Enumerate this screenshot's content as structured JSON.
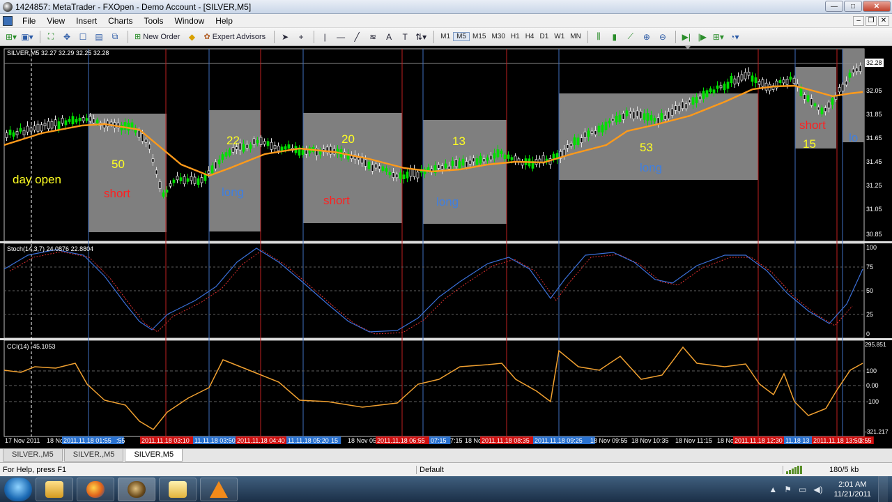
{
  "window": {
    "title": "1424857: MetaTrader - FXOpen - Demo Account - [SILVER,M5]",
    "controls": {
      "minimize": "—",
      "maximize": "□",
      "close": "✕"
    }
  },
  "menu": {
    "items": [
      "File",
      "View",
      "Insert",
      "Charts",
      "Tools",
      "Window",
      "Help"
    ],
    "mdi_controls": [
      "–",
      "❐",
      "✕"
    ]
  },
  "toolbar": {
    "new_order_label": "New Order",
    "expert_advisors_label": "Expert Advisors",
    "timeframes": [
      "M1",
      "M5",
      "M15",
      "M30",
      "H1",
      "H4",
      "D1",
      "W1",
      "MN"
    ],
    "active_timeframe": "M5",
    "icons": [
      "new-chart-icon",
      "profiles-icon",
      "zoom-chart-icon",
      "crosshair-icon",
      "navigator-icon",
      "terminal-icon",
      "tester-icon",
      "new-order-icon",
      "alert-icon",
      "expert-advisors-icon",
      "cursor-icon",
      "crosshair-tool-icon",
      "vertical-line-icon",
      "horizontal-line-icon",
      "trendline-icon",
      "fibonacci-icon",
      "text-icon",
      "label-icon",
      "arrows-icon",
      "bar-chart-icon",
      "candlestick-icon",
      "line-chart-icon",
      "zoom-in-icon",
      "zoom-out-icon",
      "autoscroll-icon",
      "chart-shift-icon",
      "indicators-icon",
      "periods-icon"
    ]
  },
  "chart": {
    "main_label": "SILVER,M5  32.27 32.29 32.25 32.28",
    "current_price": "32.28",
    "price_scale": [
      "32.05",
      "31.85",
      "31.65",
      "31.45",
      "31.25",
      "31.05",
      "30.85"
    ],
    "stoch_label": "Stoch(14,3,7) 24.0876 22.8804",
    "stoch_scale": [
      "100",
      "75",
      "50",
      "25",
      "0"
    ],
    "cci_label": "CCI(14) -45.1053",
    "cci_scale": [
      "295.851",
      "100",
      "0.00",
      "-100",
      "-321.217"
    ],
    "annotations": {
      "day_open": "day open",
      "boxes": [
        {
          "number": "50",
          "direction": "short"
        },
        {
          "number": "22",
          "direction": "long"
        },
        {
          "number": "20",
          "direction": "short"
        },
        {
          "number": "13",
          "direction": "long"
        },
        {
          "number": "53",
          "direction": "long"
        },
        {
          "number": "15",
          "direction": "short"
        },
        {
          "number": "",
          "direction": "lo"
        }
      ]
    },
    "time_axis": [
      {
        "label": "17 Nov 2011",
        "style": "plain"
      },
      {
        "label": "18 No",
        "style": "plain"
      },
      {
        "label": "2011.11.18 01:55",
        "style": "blue"
      },
      {
        "label": ":55",
        "style": "plain"
      },
      {
        "label": "2011.11.18 03:10",
        "style": "red"
      },
      {
        "label": "11.11.18 03:50",
        "style": "blue"
      },
      {
        "label": "2011.11.18 04:40",
        "style": "red"
      },
      {
        "label": "11.11.18 05:20",
        "style": "blue"
      },
      {
        "label": "15",
        "style": "plain"
      },
      {
        "label": "18 Nov 05:55",
        "style": "plain"
      },
      {
        "label": "2011.11.18 06:55",
        "style": "red"
      },
      {
        "label": "07:15",
        "style": "blue"
      },
      {
        "label": "7:15",
        "style": "plain"
      },
      {
        "label": "18 No",
        "style": "plain"
      },
      {
        "label": "2011.11.18 08:35",
        "style": "red"
      },
      {
        "label": "2011.11.18 09:25",
        "style": "blue"
      },
      {
        "label": "18 Nov 09:55",
        "style": "plain"
      },
      {
        "label": "18 Nov 10:35",
        "style": "plain"
      },
      {
        "label": "18 Nov 11:15",
        "style": "plain"
      },
      {
        "label": "18 No",
        "style": "plain"
      },
      {
        "label": "2011.11.18 12:30",
        "style": "red"
      },
      {
        "label": "11.18 13",
        "style": "blue"
      },
      {
        "label": "2011.11.18 13:50",
        "style": "red"
      },
      {
        "label": "3:55",
        "style": "plain"
      }
    ]
  },
  "tabs": [
    "SILVER.,M5",
    "SILVER.,M5",
    "SILVER,M5"
  ],
  "active_tab": 2,
  "status": {
    "help": "For Help, press F1",
    "profile": "Default",
    "traffic": "180/5 kb"
  },
  "taskbar": {
    "apps": [
      "outlook",
      "firefox",
      "metatrader",
      "explorer",
      "vlc"
    ],
    "time": "2:01 AM",
    "date": "11/21/2011"
  },
  "colors": {
    "chart_bg": "#000000",
    "bull_candle": "#00e000",
    "ma_line": "#ff9a1a",
    "box_fill": "#7f7f7f",
    "short_text": "#ff2020",
    "long_text": "#3f7fe0",
    "number_text": "#ffff22",
    "stoch_main": "#3a6fd8",
    "stoch_signal": "#e03030",
    "cci_line": "#f0a030"
  }
}
